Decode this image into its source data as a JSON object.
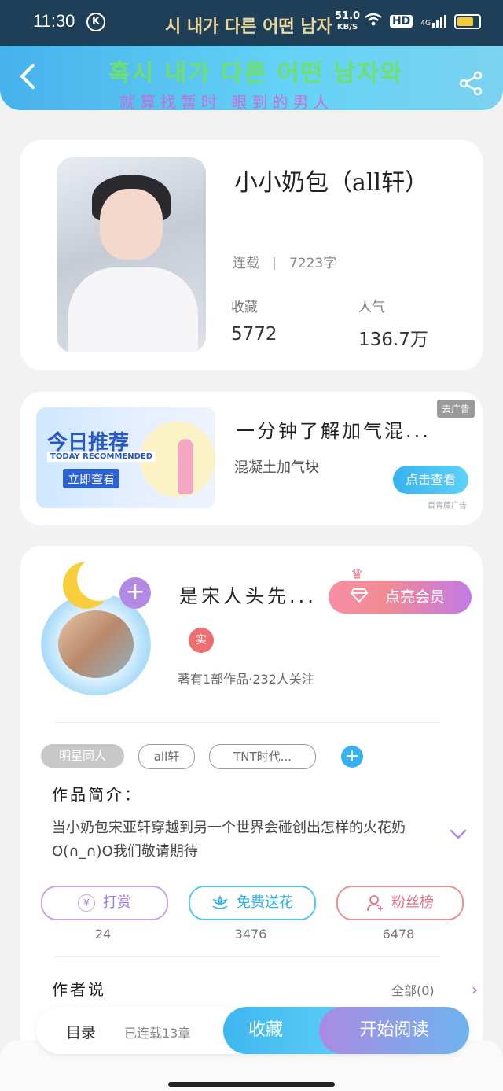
{
  "status_bar": {
    "time": "11:30",
    "k_badge": "K",
    "ticker": "시 내가 다른 어떤 남자",
    "net_speed": "51.0",
    "net_unit": "KB/S",
    "hd": "HD",
    "signal": "4G",
    "battery_color": "#f6c93a"
  },
  "header": {
    "back_icon": "chevron-left",
    "banner_line1": "혹시 내가 다른 어떤 남자와",
    "banner_line2": "就算找暂时 眼到的男人",
    "share_icon": "share",
    "gradient": [
      "#46b2ec",
      "#66d3f6"
    ]
  },
  "book": {
    "title": "小小奶包（all轩）",
    "status": "连载",
    "word_count": "7223字",
    "favorites_label": "收藏",
    "favorites_value": "5772",
    "popularity_label": "人气",
    "popularity_value": "136.7万"
  },
  "ad": {
    "image_title": "今日推荐",
    "image_subtitle": "TODAY RECOMMENDED",
    "image_cta": "立即查看",
    "title": "一分钟了解加气混...",
    "subtitle": "混凝土加气块",
    "tag": "去广告",
    "button": "点击查看",
    "source": "百青藤广告"
  },
  "author": {
    "name": "是宋人头先...",
    "vip_button": "点亮会员",
    "badge": "实",
    "meta": "著有1部作品·232人关注",
    "follow_plus": "+"
  },
  "tags": [
    "明星同人",
    "all轩",
    "TNT时代..."
  ],
  "tag_add": "+",
  "intro": {
    "label": "作品简介：",
    "text": "当小奶包宋亚轩穿越到另一个世界会碰创出怎样的火花奶O(∩_∩)O我们敬请期待"
  },
  "actions": [
    {
      "label": "打赏",
      "count": "24",
      "icon": "yen-icon"
    },
    {
      "label": "免费送花",
      "count": "3476",
      "icon": "flower-icon"
    },
    {
      "label": "粉丝榜",
      "count": "6478",
      "icon": "user-icon"
    }
  ],
  "author_says": {
    "label": "作者说",
    "all": "全部(0)"
  },
  "bottom_bar": {
    "toc": "目录",
    "serial_info": "已连载13章",
    "favorite": "收藏",
    "read": "开始阅读"
  }
}
